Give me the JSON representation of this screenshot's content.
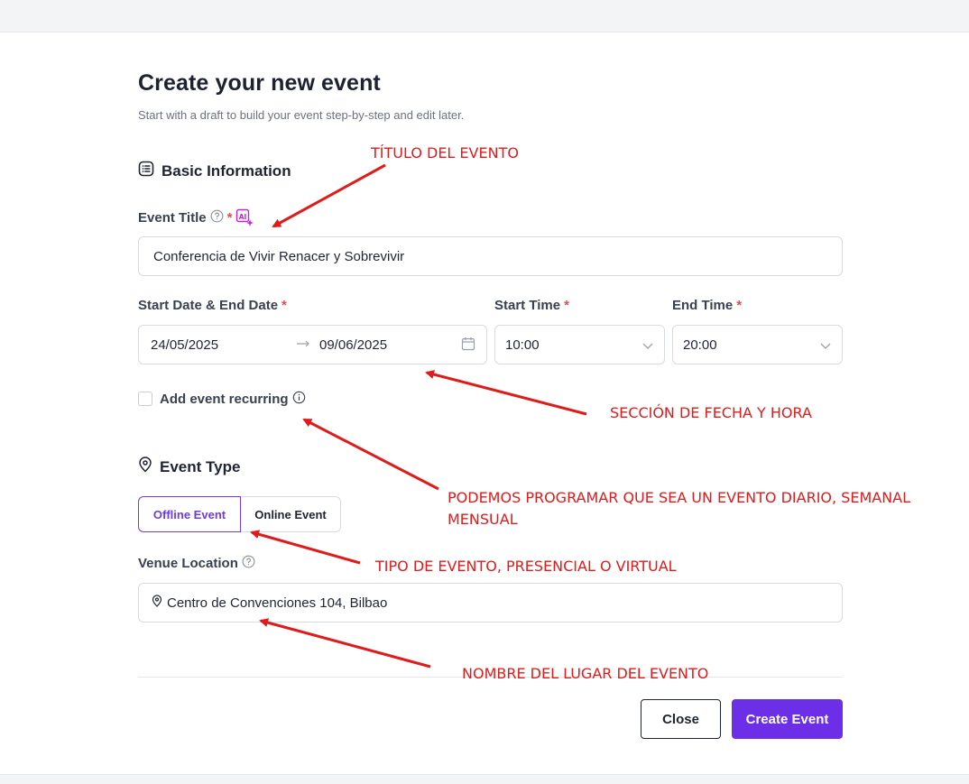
{
  "header": {
    "title": "Create your new event",
    "subtitle": "Start with a draft to build your event step-by-step and edit later."
  },
  "basic_info": {
    "heading": "Basic Information",
    "heading_icon": "list-icon",
    "event_title_label": "Event Title",
    "required_mark": "*",
    "ai_badge_text": "AI",
    "event_title_value": "Conferencia de Vivir Renacer y Sobrevivir"
  },
  "dates": {
    "date_label": "Start Date & End Date",
    "start_date": "24/05/2025",
    "end_date": "09/06/2025",
    "start_time_label": "Start Time",
    "start_time": "10:00",
    "end_time_label": "End Time",
    "end_time": "20:00",
    "recurring_label": "Add event recurring",
    "recurring_checked": false
  },
  "event_type": {
    "heading": "Event Type",
    "heading_icon": "map-pin-icon",
    "options": [
      "Offline Event",
      "Online Event"
    ],
    "selected": "Offline Event",
    "venue_label": "Venue Location",
    "venue_value": "Centro de Convenciones 104, Bilbao"
  },
  "actions": {
    "close_label": "Close",
    "create_label": "Create Event"
  },
  "annotations": {
    "title_note": "TÍTULO DEL EVENTO",
    "date_note": "SECCIÓN DE FECHA Y HORA",
    "recurring_note_line1": "PODEMOS PROGRAMAR QUE SEA UN EVENTO DIARIO, SEMANAL",
    "recurring_note_line2": "MENSUAL",
    "type_note": "TIPO DE EVENTO, PRESENCIAL O VIRTUAL",
    "venue_note": "NOMBRE DEL LUGAR DEL EVENTO"
  },
  "colors": {
    "accent": "#6d2ee8",
    "annotation": "#e01b1b",
    "required": "#e5484d",
    "ai_badge": "#c026d3"
  }
}
